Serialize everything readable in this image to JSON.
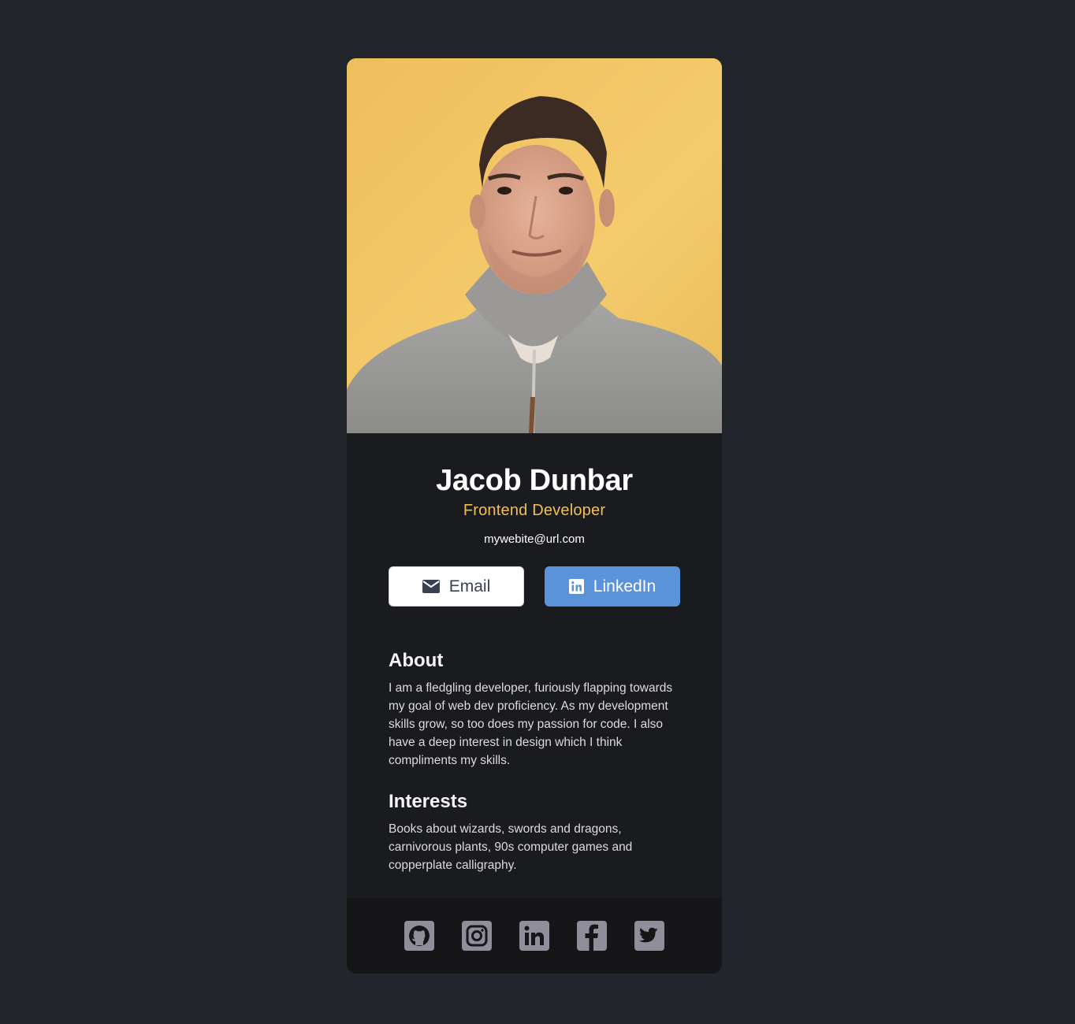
{
  "profile": {
    "name": "Jacob Dunbar",
    "title": "Frontend Developer",
    "website": "mywebite@url.com"
  },
  "buttons": {
    "email_label": "Email",
    "email_icon": "envelope-icon",
    "linkedin_label": "LinkedIn",
    "linkedin_icon": "linkedin-icon"
  },
  "about": {
    "heading": "About",
    "text": "I am a fledgling developer, furiously flapping towards my goal of web dev proficiency. As my development skills grow, so too does my passion for code. I also have a deep interest in design which I think compliments my skills."
  },
  "interests": {
    "heading": "Interests",
    "text": "Books about wizards, swords and dragons, carnivorous plants, 90s computer games and copperplate calligraphy."
  },
  "footer": {
    "icons": [
      "github-icon",
      "instagram-icon",
      "linkedin-icon",
      "facebook-icon",
      "twitter-icon"
    ]
  },
  "colors": {
    "page_bg": "#23252c",
    "card_bg": "#1a1b1f",
    "footer_bg": "#161619",
    "accent_title": "#f3bf4f",
    "linkedin_button": "#5b93db",
    "social_icon": "#918e9b"
  }
}
